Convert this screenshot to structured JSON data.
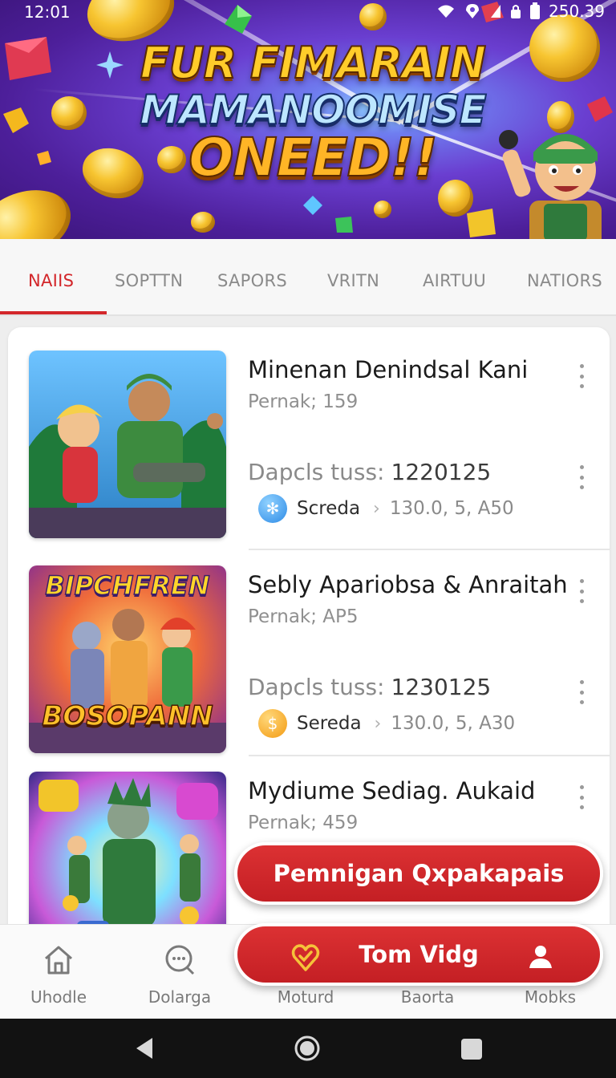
{
  "status_bar": {
    "time": "12:01",
    "battery": "250.39"
  },
  "banner": {
    "line1": "FUR FIMARAIN",
    "line2": "MAMANOOMISE",
    "line3": "ONEED!!"
  },
  "tabs": [
    {
      "label": "NAIIS",
      "active": true
    },
    {
      "label": "SOPTTN",
      "active": false
    },
    {
      "label": "SAPORS",
      "active": false
    },
    {
      "label": "VRITN",
      "active": false
    },
    {
      "label": "AIRTUU",
      "active": false
    },
    {
      "label": "NATIORS",
      "active": false
    }
  ],
  "items": [
    {
      "title": "Minenan Denindsal Kani",
      "subtitle": "Pernak; 159",
      "stat_label": "Dapcls tuss:",
      "stat_value": "1220125",
      "publisher": "Screda",
      "version": "130.0, 5, A50",
      "badge_color": "#2e8be6",
      "badge_icon": "snowflake-icon"
    },
    {
      "title": "Sebly Apariobsa & Anraitah",
      "subtitle": "Pernak; AP5",
      "stat_label": "Dapcls tuss:",
      "stat_value": "1230125",
      "publisher": "Sereda",
      "version": "130.0, 5, A30",
      "badge_color": "#f39a12",
      "badge_icon": "coin-icon",
      "thumb_text_top": "BIPCHFREN",
      "thumb_text_bottom": "BOSOPANN"
    },
    {
      "title": "Mydiume Sediag. Aukaid",
      "subtitle": "Pernak; 459"
    }
  ],
  "buttons": {
    "primary": "Pemnigan Qxpakapais",
    "secondary": "Tom Vidg"
  },
  "bottom_nav": [
    {
      "label": "Uhodle",
      "icon": "home-icon"
    },
    {
      "label": "Dolarga",
      "icon": "search-chat-icon"
    },
    {
      "label": "Moturd",
      "icon": "heart-check-icon"
    },
    {
      "label": "Baorta",
      "icon": "tag-icon"
    },
    {
      "label": "Mobks",
      "icon": "user-icon"
    }
  ],
  "colors": {
    "accent": "#d3272b",
    "banner_purple": "#5a27b0"
  }
}
